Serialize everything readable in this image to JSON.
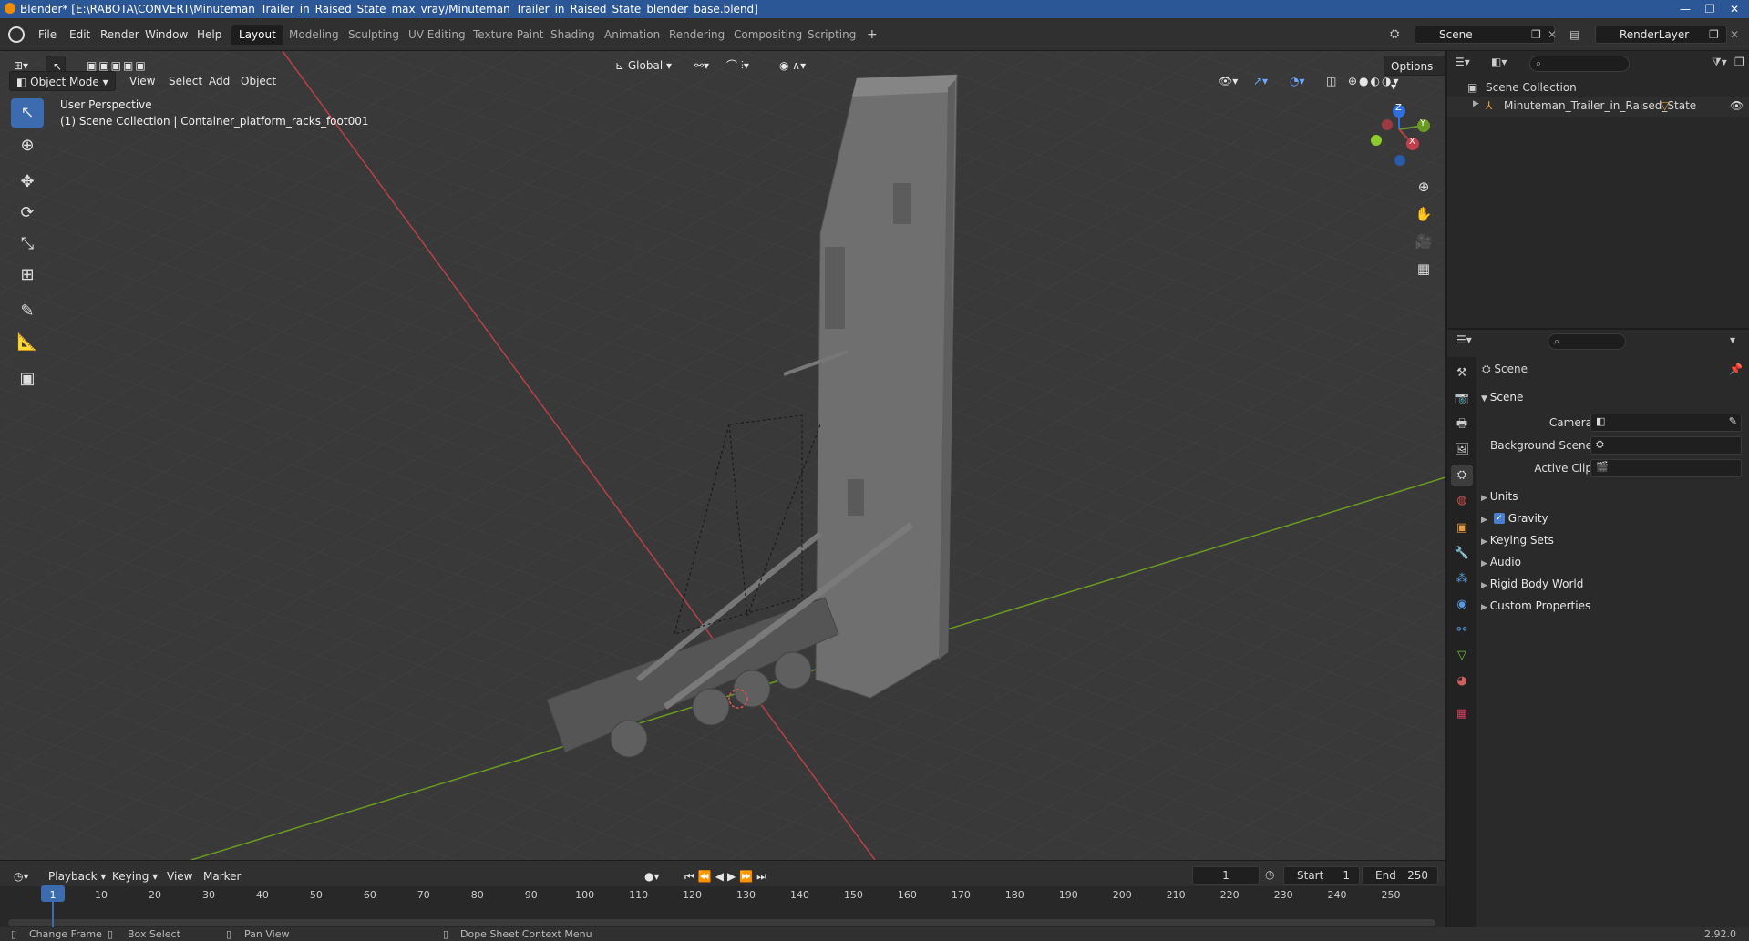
{
  "window": {
    "title": "Blender* [E:\\RABOTA\\CONVERT\\Minuteman_Trailer_in_Raised_State_max_vray/Minuteman_Trailer_in_Raised_State_blender_base.blend]",
    "controls": [
      "—",
      "❐",
      "✕"
    ]
  },
  "menu": [
    "File",
    "Edit",
    "Render",
    "Window",
    "Help"
  ],
  "workspaces": {
    "active": "Layout",
    "tabs": [
      "Layout",
      "Modeling",
      "Sculpting",
      "UV Editing",
      "Texture Paint",
      "Shading",
      "Animation",
      "Rendering",
      "Compositing",
      "Scripting"
    ],
    "add": "+"
  },
  "scene_selector": {
    "value": "Scene"
  },
  "layer_selector": {
    "value": "RenderLayer"
  },
  "viewport": {
    "mode": "Object Mode",
    "menus": [
      "View",
      "Select",
      "Add",
      "Object"
    ],
    "transform_orientation": "Global",
    "options": "Options",
    "overlay_title": "User Perspective",
    "overlay_subtitle": "(1) Scene Collection | Container_platform_racks_foot001",
    "gizmo": {
      "z": "Z",
      "y": "Y",
      "x": "X"
    }
  },
  "outliner": {
    "root": "Scene Collection",
    "items": [
      "Minuteman_Trailer_in_Raised_State"
    ]
  },
  "properties": {
    "context": "Scene",
    "panel": "Scene",
    "fields": [
      {
        "label": "Camera"
      },
      {
        "label": "Background Scene"
      },
      {
        "label": "Active Clip"
      }
    ],
    "subpanels": [
      "Units",
      "Gravity",
      "Keying Sets",
      "Audio",
      "Rigid Body World",
      "Custom Properties"
    ],
    "gravity_checked": true
  },
  "timeline": {
    "menus": [
      "Playback",
      "Keying",
      "View",
      "Marker"
    ],
    "current_frame": "1",
    "start_label": "Start",
    "start": "1",
    "end_label": "End",
    "end": "250",
    "ticks": [
      "1",
      "10",
      "20",
      "30",
      "40",
      "50",
      "60",
      "70",
      "80",
      "90",
      "100",
      "110",
      "120",
      "130",
      "140",
      "150",
      "160",
      "170",
      "180",
      "190",
      "200",
      "210",
      "220",
      "230",
      "240",
      "250"
    ]
  },
  "statusbar": {
    "items": [
      "Change Frame",
      "Box Select",
      "Pan View",
      "Dope Sheet Context Menu"
    ],
    "version": "2.92.0"
  },
  "colors": {
    "accent": "#3d6bb0",
    "x_axis": "#c0404a",
    "y_axis": "#6b9a22",
    "z_axis": "#2f6fe0"
  }
}
